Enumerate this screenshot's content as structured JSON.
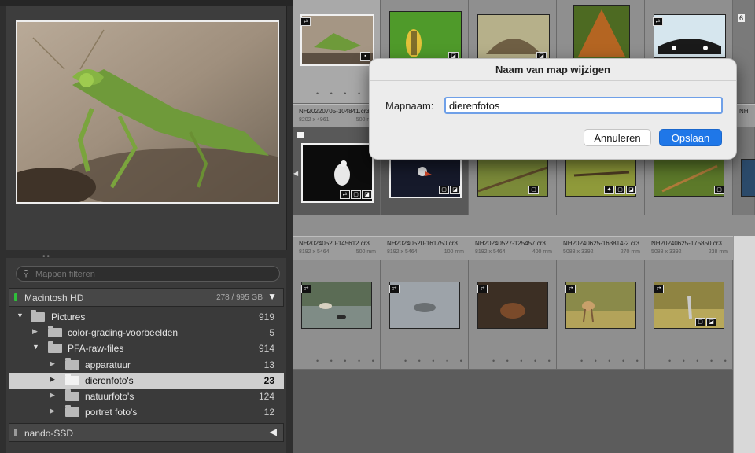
{
  "folders": {
    "filter_placeholder": "Mappen filteren",
    "volumes": [
      {
        "name": "Macintosh HD",
        "info": "278 / 995 GB",
        "status_color": "#2fbf3a"
      },
      {
        "name": "nando-SSD"
      }
    ],
    "items": [
      {
        "name": "Pictures",
        "count": "919"
      },
      {
        "name": "color-grading-voorbeelden",
        "count": "5"
      },
      {
        "name": "PFA-raw-files",
        "count": "914"
      },
      {
        "name": "apparatuur",
        "count": "13"
      },
      {
        "name": "dierenfoto's",
        "count": "23"
      },
      {
        "name": "natuurfoto's",
        "count": "124"
      },
      {
        "name": "portret foto's",
        "count": "12"
      }
    ]
  },
  "grid": {
    "row1_meta": [
      {
        "file": "NH20220705-104841.cr3",
        "dims": "8202 x 4961",
        "size": "500 mm"
      }
    ],
    "row3_meta": [
      {
        "file": "NH20240520-145612.cr3",
        "dims": "8192 x 5464",
        "size": "500 mm"
      },
      {
        "file": "NH20240520-161750.cr3",
        "dims": "8192 x 5464",
        "size": "100 mm"
      },
      {
        "file": "NH20240527-125457.cr3",
        "dims": "8192 x 5464",
        "size": "400 mm"
      },
      {
        "file": "NH20240625-163814-2.cr3",
        "dims": "5088 x 3392",
        "size": "270 mm"
      },
      {
        "file": "NH20240625-175850.cr3",
        "dims": "5088 x 3392",
        "size": "238 mm"
      }
    ],
    "edge_labels": {
      "top": "6",
      "meta_cut": "NH"
    },
    "dots": "• • • • •"
  },
  "dialog": {
    "title": "Naam van map wijzigen",
    "label": "Mapnaam:",
    "value": "dierenfotos",
    "cancel": "Annuleren",
    "save": "Opslaan",
    "accent": "#1f77e8"
  }
}
